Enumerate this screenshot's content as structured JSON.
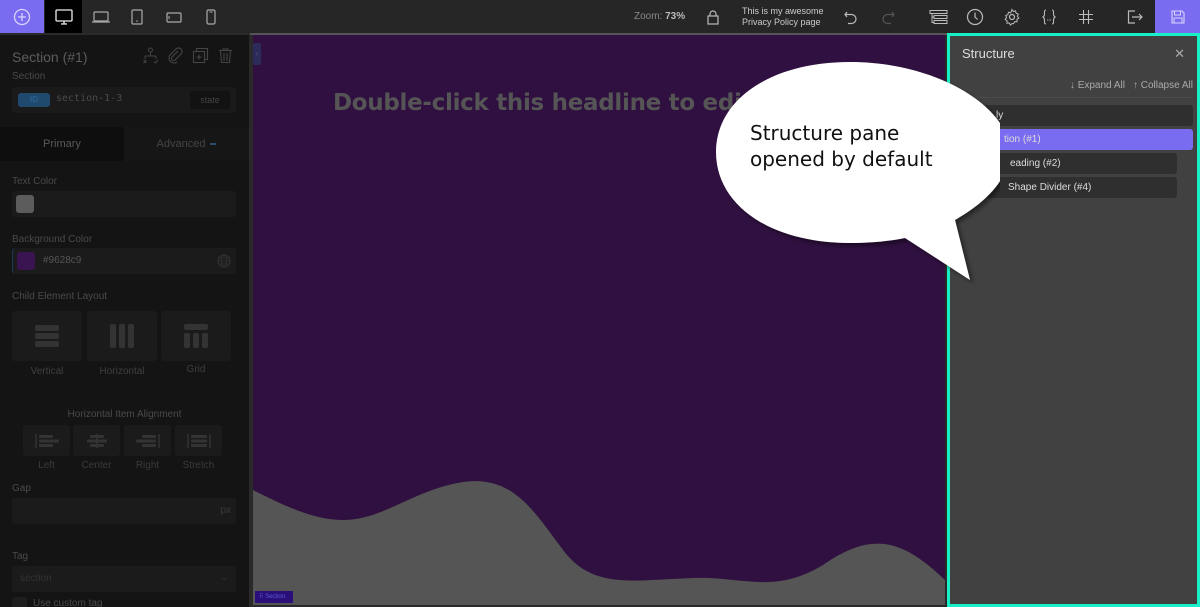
{
  "topbar": {
    "zoom_label": "Zoom:",
    "zoom_value": "73%",
    "page_title_line1": "This is my awesome",
    "page_title_line2": "Privacy Policy page",
    "devices": [
      "desktop-icon",
      "laptop-icon",
      "tablet-portrait-icon",
      "tablet-landscape-icon",
      "mobile-icon"
    ],
    "active_device": "desktop",
    "accent_color": "#7a6cf0"
  },
  "left_panel": {
    "title": "Section (#1)",
    "subtitle": "Section",
    "id_badge": "ID",
    "id_value": "section-1-3",
    "state_label": "state",
    "tabs": [
      {
        "label": "Primary",
        "active": true
      },
      {
        "label": "Advanced",
        "active": false
      }
    ],
    "text_color_label": "Text Color",
    "background_color_label": "Background Color",
    "background_color_value": "#9628c9",
    "child_layout_label": "Child Element Layout",
    "layout_options": [
      "Vertical",
      "Horizontal",
      "Grid"
    ],
    "alignment_label": "Horizontal Item Alignment",
    "alignment_options": [
      "Left",
      "Center",
      "Right",
      "Stretch"
    ],
    "gap_label": "Gap",
    "gap_unit": "px",
    "tag_label": "Tag",
    "tag_value": "section",
    "custom_tag_label": "Use custom tag"
  },
  "canvas": {
    "headline": "Double-click this headline to edi",
    "section_tag": "Section",
    "background_color": "#301040",
    "divider_color": "#555555"
  },
  "structure": {
    "title": "Structure",
    "expand_all": "↓ Expand All",
    "collapse_all": "↑ Collapse All",
    "items": [
      {
        "label": "ly",
        "selected": false
      },
      {
        "label": "tion (#1)",
        "selected": true
      },
      {
        "label": "eading (#2)",
        "selected": false
      },
      {
        "label": "Shape Divider (#4)",
        "selected": false
      }
    ],
    "border_color": "#18f0c8"
  },
  "callout": {
    "line1": "Structure pane",
    "line2": "opened by default"
  }
}
